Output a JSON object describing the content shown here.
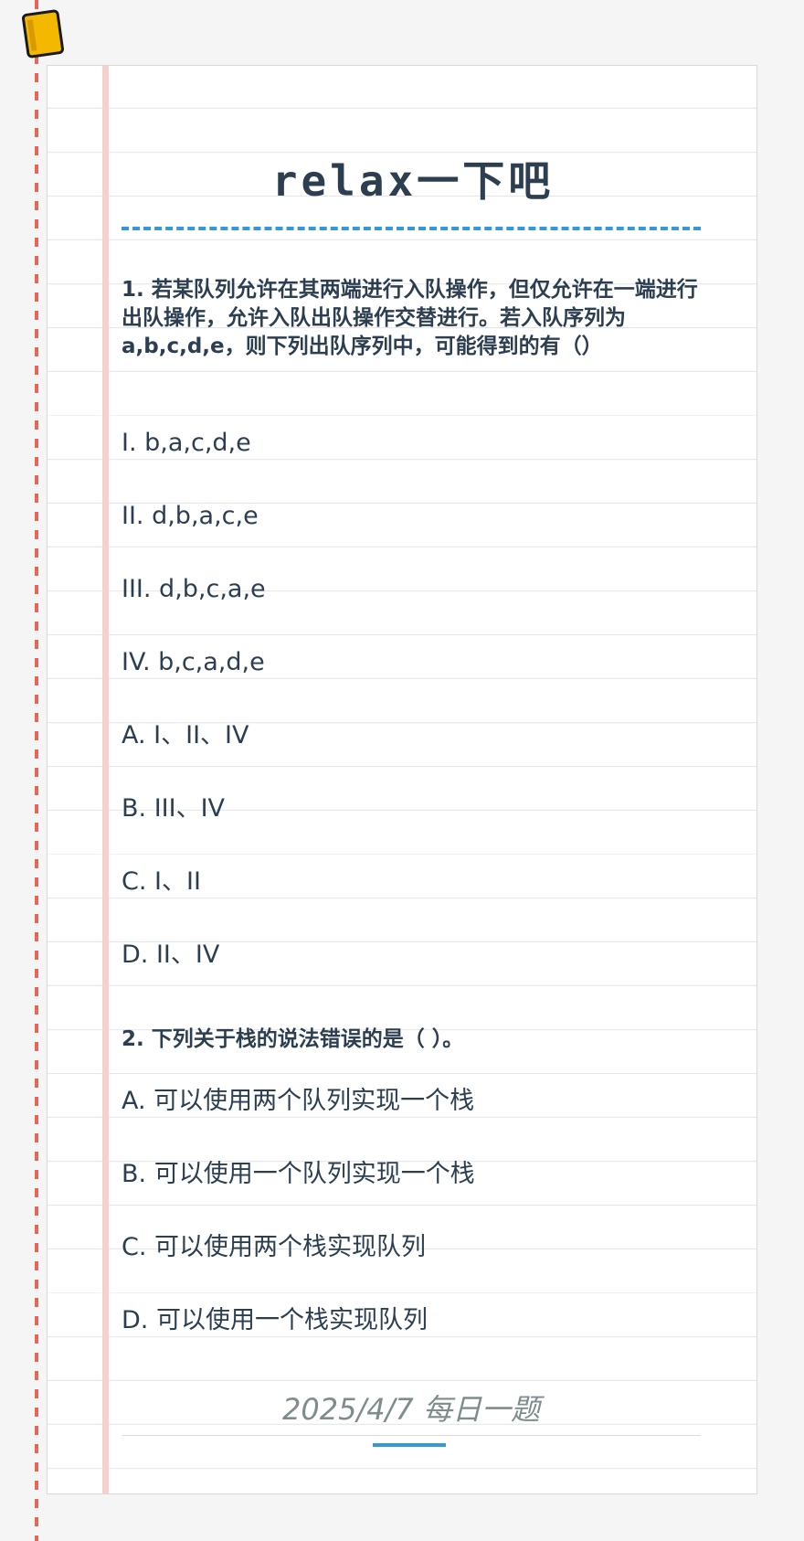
{
  "header": {
    "title": "relax一下吧"
  },
  "questions": [
    {
      "title": "1. 若某队列允许在其两端进行入队操作，但仅允许在一端进行出队操作，允许入队出队操作交替进行。若入队序列为a,b,c,d,e，则下列出队序列中，可能得到的有（）",
      "options": [
        "I. b,a,c,d,e",
        "II. d,b,a,c,e",
        "III. d,b,c,a,e",
        "IV. b,c,a,d,e",
        "A. I、II、IV",
        "B. III、IV",
        "C. I、II",
        "D. II、IV"
      ]
    },
    {
      "title": "2. 下列关于栈的说法错误的是（ ）。",
      "options": [
        "A. 可以使用两个队列实现一个栈",
        "B. 可以使用一个队列实现一个栈",
        "C. 可以使用两个栈实现队列",
        "D. 可以使用一个栈实现队列"
      ]
    }
  ],
  "footer": {
    "date_label": "2025/4/7 每日一题"
  },
  "colors": {
    "accent": "#3498db",
    "margin_dash": "#e74c3c",
    "text": "#2c3e50",
    "muted": "#7f8c8d",
    "icon_fill": "#f5b800"
  },
  "icons": {
    "corner": "notebook-icon"
  }
}
